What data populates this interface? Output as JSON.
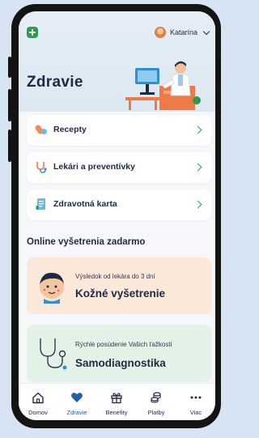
{
  "header": {
    "user_name": "Katarína"
  },
  "page_title": "Zdravie",
  "menu": [
    {
      "label": "Recepty",
      "icon": "pills-icon"
    },
    {
      "label": "Lekári a preventívky",
      "icon": "stethoscope-icon"
    },
    {
      "label": "Zdravotná karta",
      "icon": "health-card-icon"
    }
  ],
  "section_title": "Online vyšetrenia zadarmo",
  "promos": [
    {
      "subtitle": "Výsledok od lekára do 3 dní",
      "title": "Kožné vyšetrenie"
    },
    {
      "subtitle": "Rýchle posúdenie Vašich ťažkostí",
      "title": "Samodiagnostika"
    }
  ],
  "tabs": [
    {
      "label": "Domov",
      "icon": "home-icon",
      "active": false
    },
    {
      "label": "Zdravie",
      "icon": "heart-icon",
      "active": true
    },
    {
      "label": "Benefity",
      "icon": "gift-icon",
      "active": false
    },
    {
      "label": "Platby",
      "icon": "coins-icon",
      "active": false
    },
    {
      "label": "Viac",
      "icon": "more-icon",
      "active": false
    }
  ],
  "colors": {
    "accent_green": "#2e9a4a",
    "active_blue": "#1f5fae",
    "text_dark": "#1e2a44",
    "promo_peach": "#fbe8d9",
    "promo_mint": "#e3f2e6"
  }
}
